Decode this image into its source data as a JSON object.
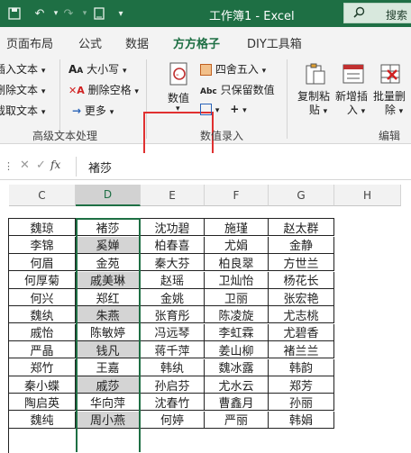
{
  "titlebar": {
    "title": "工作簿1  -  Excel",
    "search_label": "搜索",
    "icons": [
      "save-icon",
      "undo-icon",
      "redo-icon",
      "touch-mode-icon",
      "customize-qat-icon",
      "search-icon"
    ]
  },
  "tabs": [
    {
      "label": "页面布局",
      "active": false
    },
    {
      "label": "公式",
      "active": false
    },
    {
      "label": "数据",
      "active": false
    },
    {
      "label": "方方格子",
      "active": true
    },
    {
      "label": "DIY工具箱",
      "active": false
    }
  ],
  "ribbon": {
    "text_group": {
      "insert_text": "插入文本",
      "delete_text": "删除文本",
      "extract_text": "截取文本",
      "case": "大小写",
      "delete_space": "删除空格",
      "more": "更多",
      "label": "高级文本处理"
    },
    "numeric_group": {
      "value_button": "数值",
      "round": "四舍五入",
      "keep_values": "只保留数值",
      "label": "数值录入"
    },
    "edit_group": {
      "copy_paste": [
        "复制粘",
        "贴"
      ],
      "add_insert": [
        "新增插",
        "入"
      ],
      "batch_delete": [
        "批量删",
        "除"
      ],
      "label": "编辑"
    },
    "accent": "#1e6f44",
    "highlight": "#e03030"
  },
  "formula_bar": {
    "fx": "fx",
    "value": "褚莎"
  },
  "sheet": {
    "columns": [
      "C",
      "D",
      "E",
      "F",
      "G",
      "H"
    ],
    "selected_column": "D",
    "rows": [
      [
        "",
        "",
        "",
        "",
        "",
        ""
      ],
      [
        "魏琼",
        "褚莎",
        "沈功碧",
        "施瑾",
        "赵太群",
        ""
      ],
      [
        "李锦",
        "奚婵",
        "柏春喜",
        "尤娟",
        "金静",
        ""
      ],
      [
        "何眉",
        "金苑",
        "秦大芬",
        "柏良翠",
        "方世兰",
        ""
      ],
      [
        "何厚菊",
        "戚美琳",
        "赵瑶",
        "卫灿怡",
        "杨花长",
        ""
      ],
      [
        "何兴",
        "郑红",
        "金姚",
        "卫丽",
        "张宏艳",
        ""
      ],
      [
        "魏纨",
        "朱燕",
        "张育彤",
        "陈凌旋",
        "尤志桃",
        ""
      ],
      [
        "戚怡",
        "陈敏婷",
        "冯远琴",
        "李虹霖",
        "尤碧香",
        ""
      ],
      [
        "严晶",
        "钱凡",
        "蒋千萍",
        "姜山柳",
        "褚兰兰",
        ""
      ],
      [
        "郑竹",
        "王嘉",
        "韩纨",
        "魏冰露",
        "韩韵",
        ""
      ],
      [
        "秦小蝶",
        "戚莎",
        "孙启芬",
        "尤水云",
        "郑芳",
        ""
      ],
      [
        "陶启英",
        "华向萍",
        "沈春竹",
        "曹鑫月",
        "孙丽",
        ""
      ],
      [
        "魏纯",
        "周小燕",
        "何婷",
        "严丽",
        "韩娟",
        ""
      ]
    ]
  }
}
